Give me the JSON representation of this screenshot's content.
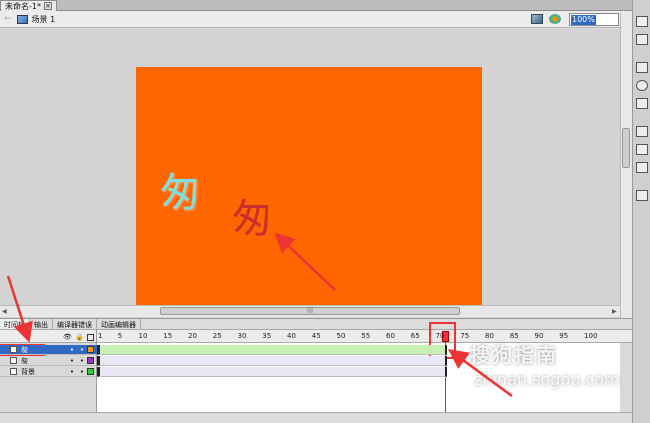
{
  "document": {
    "tab_title": "未命名-1*",
    "close_glyph": "×"
  },
  "scene": {
    "back_glyph": "←",
    "label": "场景 1",
    "zoom": "100%"
  },
  "stage": {
    "color": "#ff6600",
    "glyph_cyan": "匆",
    "glyph_red": "匆"
  },
  "timeline": {
    "tabs": [
      "时间轴",
      "输出",
      "编译器错误",
      "动画编辑器"
    ],
    "header_icons": [
      "eye-icon",
      "lock-icon",
      "outline-icon"
    ],
    "ruler": [
      "1",
      "5",
      "10",
      "15",
      "20",
      "25",
      "30",
      "35",
      "40",
      "45",
      "50",
      "55",
      "60",
      "65",
      "70",
      "75",
      "80",
      "85",
      "90",
      "95",
      "100"
    ],
    "layers": [
      {
        "name": "匆",
        "color": "#ff9900",
        "selected": true
      },
      {
        "name": "匆",
        "color": "#9933cc",
        "selected": false
      },
      {
        "name": "背景",
        "color": "#33cc33",
        "selected": false
      }
    ]
  },
  "watermark": {
    "logo": "搜狗指南",
    "url": "zhinan.sogou.com"
  },
  "scrollbar": {
    "thumb_glyph": "|||",
    "left_glyph": "◀",
    "right_glyph": "▶"
  },
  "colors": {
    "stage": "#ff6600",
    "annotation": "#ee3333",
    "selection": "#316ac5"
  }
}
